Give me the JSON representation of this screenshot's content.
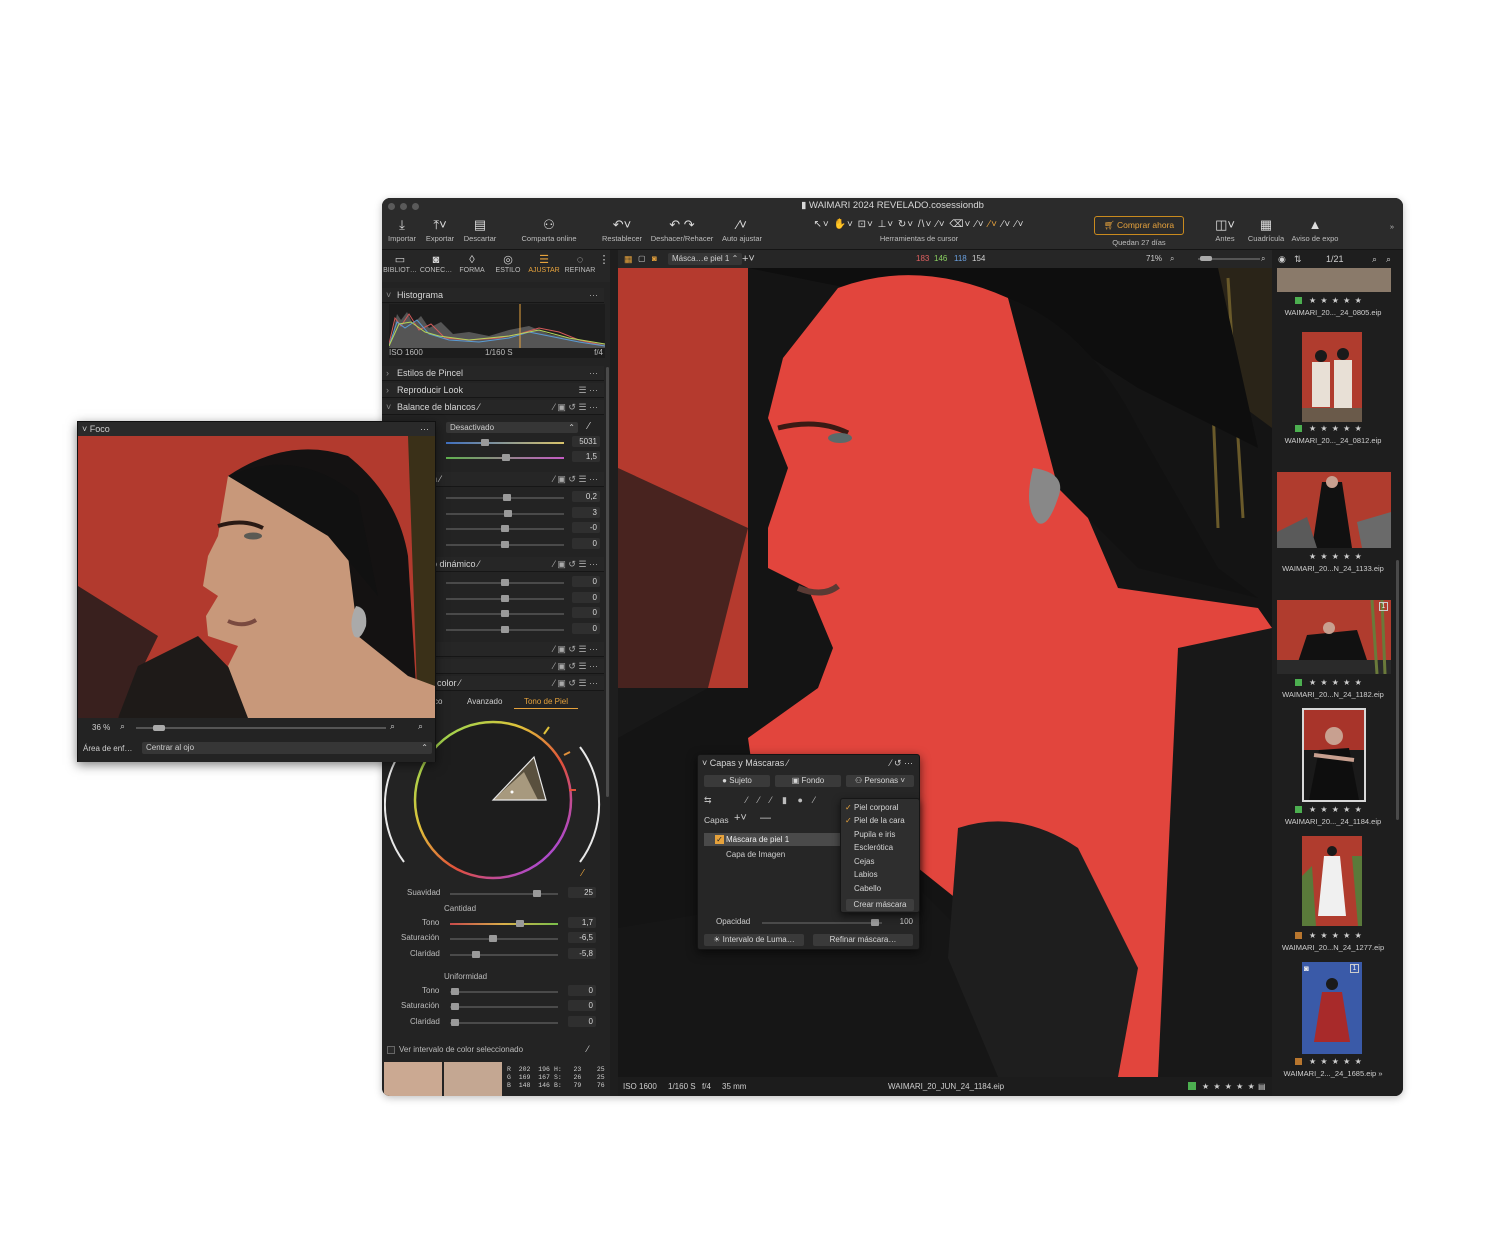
{
  "window": {
    "title": "WAIMARI 2024 REVELADO.cosessiondb"
  },
  "toolbar": {
    "importar": "Importar",
    "exportar": "Exportar",
    "descartar": "Descartar",
    "comparta": "Comparta online",
    "restablecer": "Restablecer",
    "deshacer": "Deshacer/Rehacer",
    "auto": "Auto ajustar",
    "herramientas": "Herramientas de cursor",
    "comprar": "Comprar ahora",
    "quedan": "Quedan 27 días",
    "antes": "Antes",
    "cuadricula": "Cuadrícula",
    "aviso": "Aviso de expo"
  },
  "tool_tabs": [
    "BIBLIOT…",
    "CONEC…",
    "FORMA",
    "ESTILO",
    "AJUSTAR",
    "REFINAR"
  ],
  "histogram": {
    "title": "Histograma",
    "iso": "ISO 1600",
    "speed": "1/160 S",
    "aperture": "f/4"
  },
  "sections": {
    "estilos": "Estilos de Pincel",
    "look": "Reproducir Look",
    "balance": "Balance de blancos",
    "exposure_suffix": "n",
    "hdr_suffix": "o dinámico",
    "color_suffix": "color"
  },
  "balance": {
    "mode": "Desactivado",
    "kelvin": "5031",
    "tint": "1,5"
  },
  "exposure_values": [
    "0,2",
    "3",
    "-0",
    "0"
  ],
  "dynamic_values": [
    "0",
    "0",
    "0",
    "0"
  ],
  "color_tabs": {
    "left": "co",
    "avanzado": "Avanzado",
    "tono": "Tono de Piel"
  },
  "skin": {
    "suavidad_label": "Suavidad",
    "suavidad_value": "25",
    "cantidad": "Cantidad",
    "tono_label": "Tono",
    "tono_value": "1,7",
    "sat_label": "Saturación",
    "sat_value": "-6,5",
    "clar_label": "Claridad",
    "clar_value": "-5,8",
    "uniformidad": "Uniformidad",
    "u_tono_label": "Tono",
    "u_tono_value": "0",
    "u_sat_label": "Saturación",
    "u_sat_value": "0",
    "u_clar_label": "Claridad",
    "u_clar_value": "0",
    "ver": "Ver intervalo de color seleccionado",
    "readout_left": "R  202  196\nG  169  167\nB  148  146",
    "readout_right": "H:   23    25\nS:   26    25\nB:   79    76"
  },
  "viewer": {
    "mask_select": "Másca…e piel 1",
    "rgb": {
      "r": "183",
      "g": "146",
      "b": "118",
      "l": "154"
    },
    "zoom": "71%",
    "iso": "ISO 1600",
    "speed": "1/160 S",
    "aperture": "f/4",
    "focal": "35 mm",
    "filename": "WAIMARI_20_JUN_24_1184.eip",
    "stars": "★ ★ ★ ★ ★"
  },
  "browser": {
    "count": "1/21",
    "items": [
      {
        "name": "WAIMARI_20..._24_0805.eip",
        "stars": "★ ★ ★ ★ ★",
        "tag": "#4caf50"
      },
      {
        "name": "WAIMARI_20..._24_0812.eip",
        "stars": "★ ★ ★ ★ ★",
        "tag": "#4caf50"
      },
      {
        "name": "WAIMARI_20...N_24_1133.eip",
        "stars": "★ ★ ★ ★ ★",
        "tag": ""
      },
      {
        "name": "WAIMARI_20...N_24_1182.eip",
        "stars": "★ ★ ★ ★ ★",
        "tag": "#4caf50"
      },
      {
        "name": "WAIMARI_20..._24_1184.eip",
        "stars": "★ ★ ★ ★ ★",
        "tag": "#4caf50"
      },
      {
        "name": "WAIMARI_20...N_24_1277.eip",
        "stars": "★ ★ ★ ★ ★",
        "tag": "#b8762e"
      },
      {
        "name": "WAIMARI_2..._24_1685.eip",
        "stars": "★ ★ ★ ★ ★",
        "tag": "#b8762e"
      }
    ],
    "overflow": "»"
  },
  "layers_panel": {
    "title": "Capas y Máscaras",
    "sujeto": "Sujeto",
    "fondo": "Fondo",
    "personas": "Personas",
    "capas": "Capas",
    "layer1": "Máscara de piel 1",
    "layer2": "Capa de Imagen",
    "opacidad": "Opacidad",
    "opacidad_value": "100",
    "intervalo": "Intervalo de Luma…",
    "refinar": "Refinar máscara…"
  },
  "dropdown": {
    "items": [
      {
        "label": "Piel corporal",
        "checked": "✓"
      },
      {
        "label": "Piel de la cara",
        "checked": "✓"
      },
      {
        "label": "Pupila e iris",
        "checked": ""
      },
      {
        "label": "Esclerótica",
        "checked": ""
      },
      {
        "label": "Cejas",
        "checked": ""
      },
      {
        "label": "Labios",
        "checked": ""
      },
      {
        "label": "Cabello",
        "checked": ""
      }
    ],
    "crear": "Crear máscara"
  },
  "focus": {
    "title": "Foco",
    "zoom": "36 %",
    "area_label": "Área de enf…",
    "area_value": "Centrar al ojo"
  },
  "colors": {
    "accent": "#e6a23c",
    "mask": "#e2453d",
    "panel": "#232323"
  }
}
